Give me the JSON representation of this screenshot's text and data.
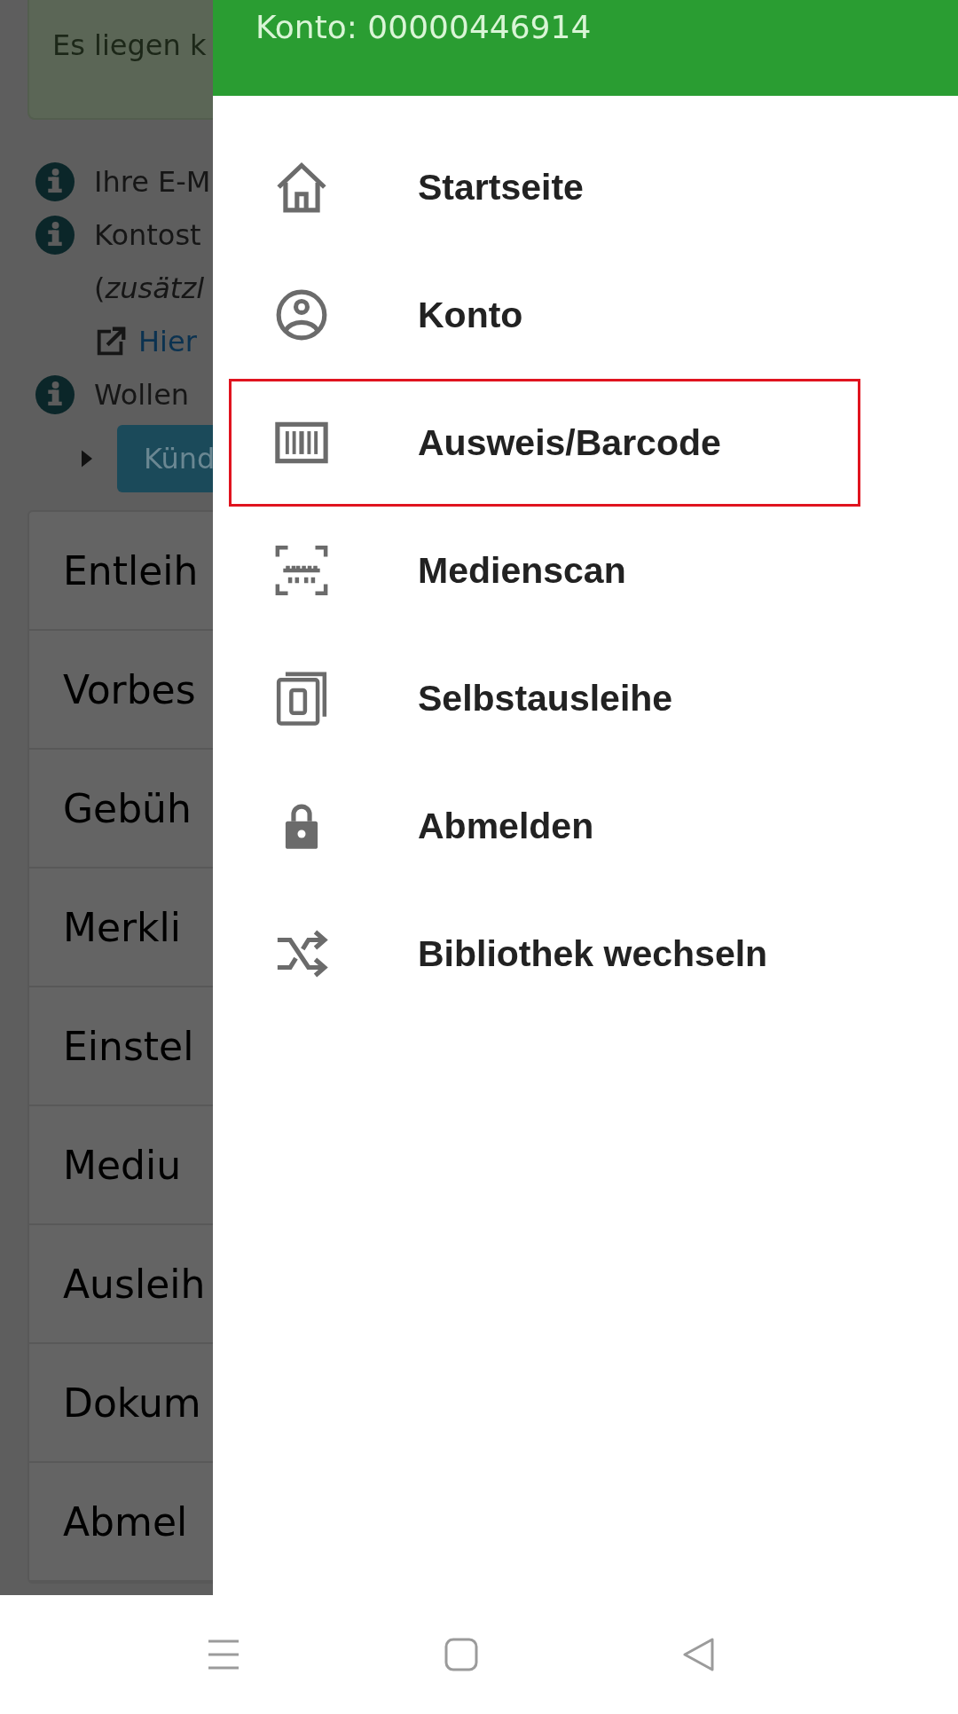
{
  "page": {
    "alert": "Es liegen k",
    "notices": [
      {
        "kind": "info",
        "text": "Ihre E-M"
      },
      {
        "kind": "info",
        "text": "Kontost"
      },
      {
        "kind": "note",
        "text": "(*zusätzl*"
      },
      {
        "kind": "link",
        "text": "Hier"
      },
      {
        "kind": "info",
        "text": "Wollen"
      },
      {
        "kind": "button",
        "text": "Künd"
      }
    ],
    "sections": [
      "Entleih",
      "Vorbes",
      "Gebüh",
      "Merkli",
      "Einstel",
      "Mediu",
      "Ausleih",
      "Dokum",
      "Abmel"
    ]
  },
  "drawer": {
    "account": "Konto: 00000446914",
    "items": [
      {
        "label": "Startseite",
        "highlighted": false
      },
      {
        "label": "Konto",
        "highlighted": false
      },
      {
        "label": "Ausweis/Barcode",
        "highlighted": true
      },
      {
        "label": "Medienscan",
        "highlighted": false
      },
      {
        "label": "Selbstausleihe",
        "highlighted": false
      },
      {
        "label": "Abmelden",
        "highlighted": false
      },
      {
        "label": "Bibliothek wechseln",
        "highlighted": false
      }
    ]
  }
}
